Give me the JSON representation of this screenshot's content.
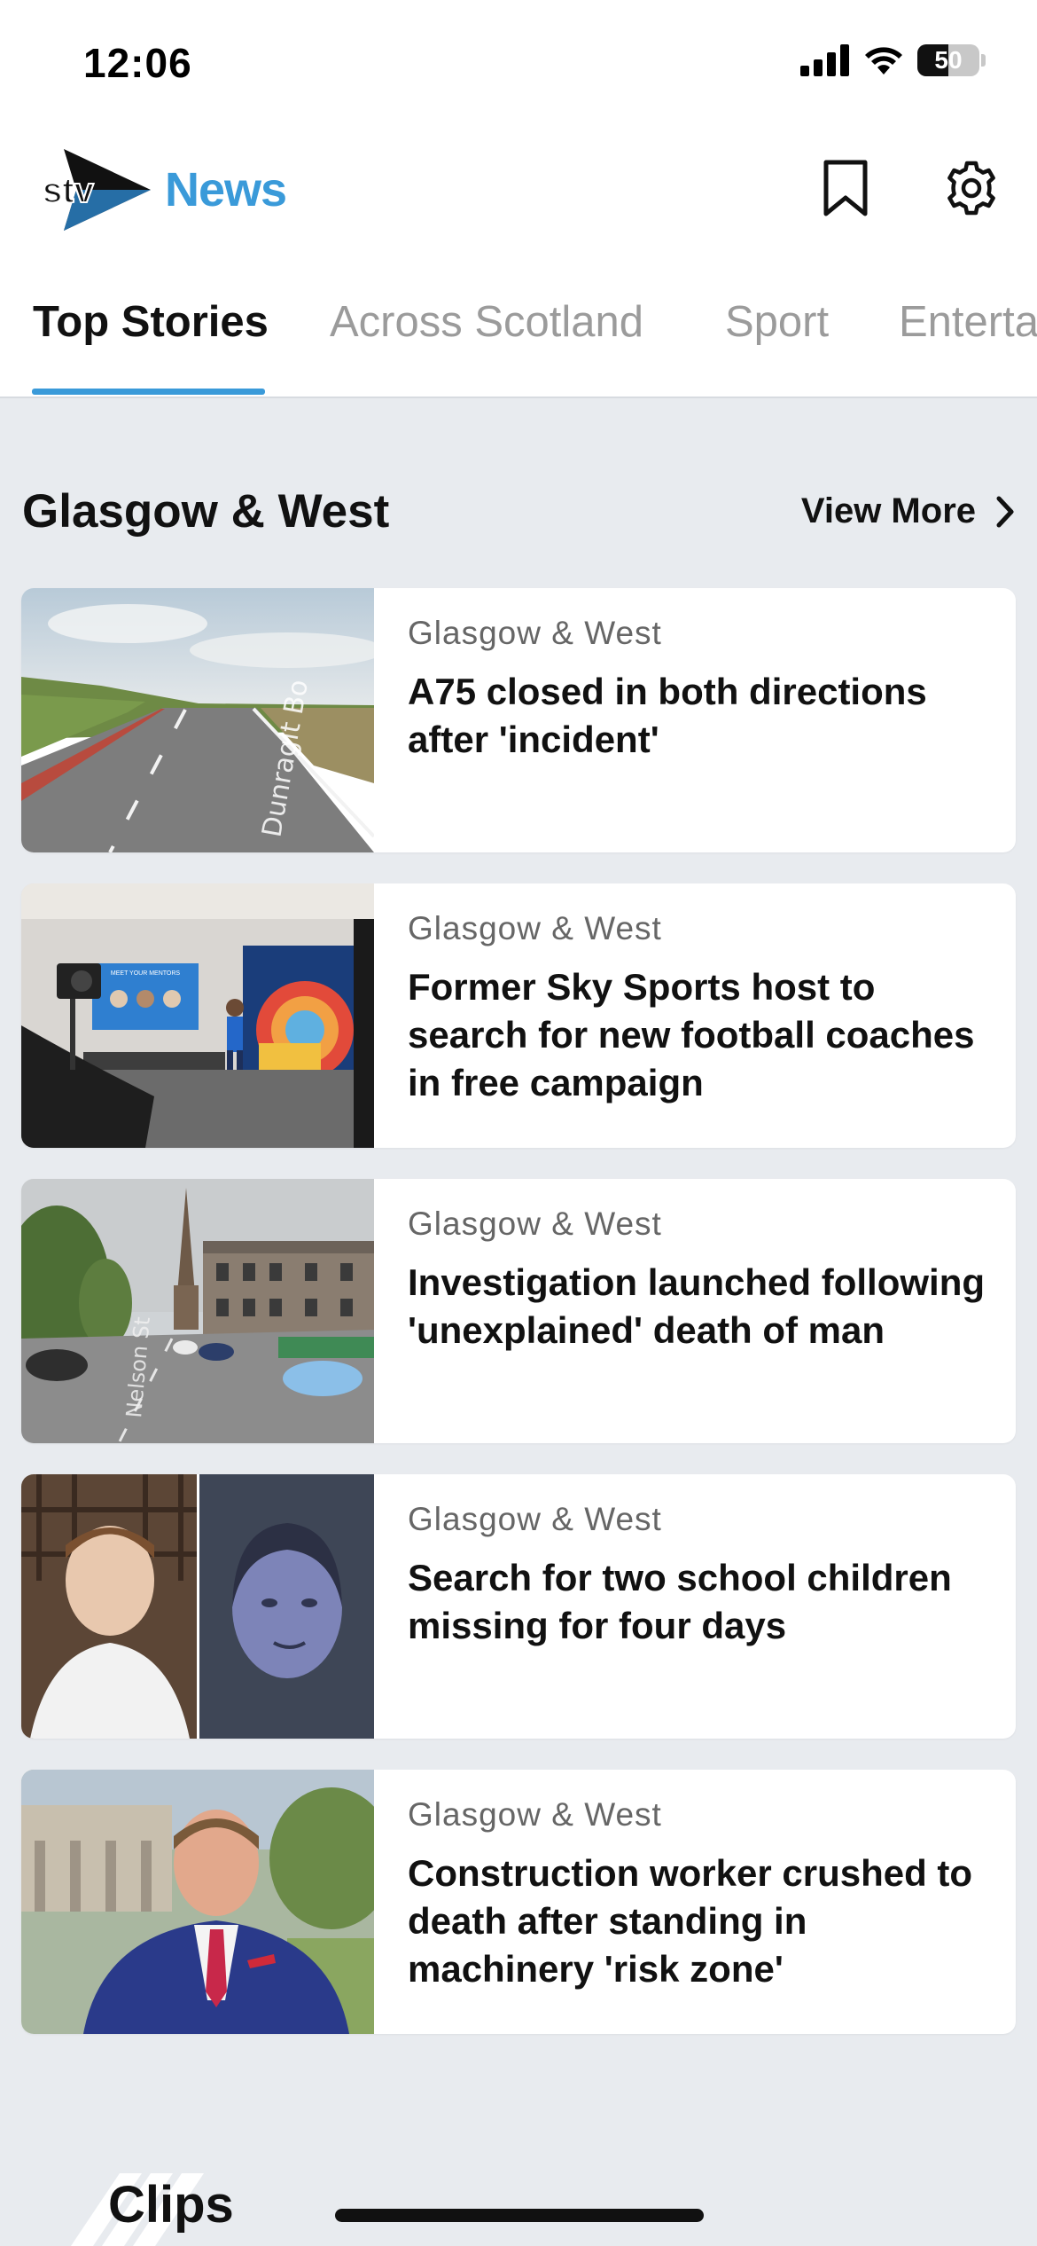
{
  "status": {
    "time": "12:06",
    "battery": "50",
    "battery_level": 0.5
  },
  "header": {
    "logo_brand": "stv",
    "logo_section": "News",
    "bookmark_icon": "bookmark-icon",
    "settings_icon": "gear-icon"
  },
  "tabs": [
    {
      "label": "Top Stories",
      "active": true
    },
    {
      "label": "Across Scotland",
      "active": false
    },
    {
      "label": "Sport",
      "active": false
    },
    {
      "label": "Enterta",
      "active": false
    }
  ],
  "section": {
    "title": "Glasgow & West",
    "view_more": "View More"
  },
  "stories": [
    {
      "category": "Glasgow & West",
      "title": "A75 closed in both directions after 'incident'",
      "image_text": "Dunragit Bo"
    },
    {
      "category": "Glasgow & West",
      "title": "Former Sky Sports host to search for new football coaches in free campaign",
      "image_text": "MEET YOUR MENTORS"
    },
    {
      "category": "Glasgow & West",
      "title": "Investigation launched following 'unexplained' death of man",
      "image_text": "Nelson St"
    },
    {
      "category": "Glasgow & West",
      "title": "Search for two school children missing for four days"
    },
    {
      "category": "Glasgow & West",
      "title": "Construction worker crushed to death after standing in machinery 'risk zone'"
    }
  ],
  "clips": {
    "label": "Clips"
  },
  "colors": {
    "accent": "#3a9ad9",
    "background": "#e8ebef",
    "card": "#ffffff",
    "text": "#111111",
    "muted": "#666666",
    "inactive_tab": "#9b9b9b"
  }
}
